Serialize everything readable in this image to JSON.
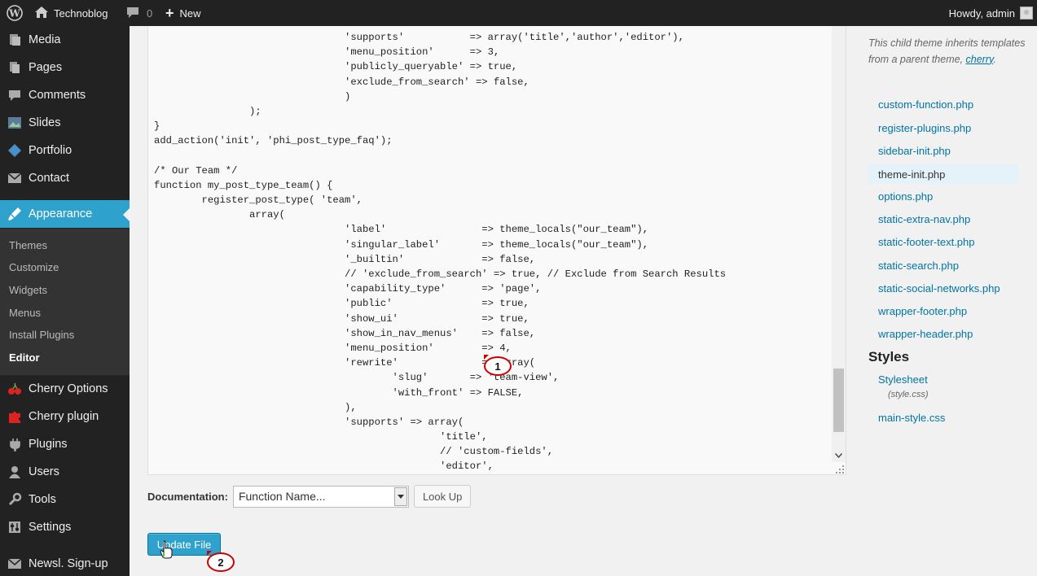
{
  "admin_bar": {
    "site_name": "Technoblog",
    "comments_count": "0",
    "new_label": "New",
    "howdy": "Howdy, admin"
  },
  "menu": {
    "items": [
      {
        "label": "Media",
        "icon": "media-icon"
      },
      {
        "label": "Pages",
        "icon": "pages-icon"
      },
      {
        "label": "Comments",
        "icon": "comments-icon"
      },
      {
        "label": "Slides",
        "icon": "slides-icon"
      },
      {
        "label": "Portfolio",
        "icon": "portfolio-icon"
      },
      {
        "label": "Contact",
        "icon": "contact-icon"
      },
      {
        "label": "Appearance",
        "icon": "appearance-icon"
      },
      {
        "label": "Cherry Options",
        "icon": "cherry-icon"
      },
      {
        "label": "Cherry plugin",
        "icon": "plugin-puzzle-icon"
      },
      {
        "label": "Plugins",
        "icon": "plugins-icon"
      },
      {
        "label": "Users",
        "icon": "users-icon"
      },
      {
        "label": "Tools",
        "icon": "tools-icon"
      },
      {
        "label": "Settings",
        "icon": "settings-icon"
      },
      {
        "label": "Newsl. Sign-up",
        "icon": "newsletter-icon"
      }
    ],
    "submenu": [
      "Themes",
      "Customize",
      "Widgets",
      "Menus",
      "Install Plugins",
      "Editor"
    ],
    "active_color": "#2ea2cc"
  },
  "editor": {
    "lines": [
      "                                'supports'           => array('title','author','editor'),",
      "                                'menu_position'      => 3,",
      "                                'publicly_queryable' => true,",
      "                                'exclude_from_search' => false,",
      "                                )",
      "                );",
      "}",
      "add_action('init', 'phi_post_type_faq');",
      "",
      "/* Our Team */",
      "function my_post_type_team() {",
      "        register_post_type( 'team',",
      "                array(",
      "                                'label'                => theme_locals(\"our_team\"),",
      "                                'singular_label'       => theme_locals(\"our_team\"),",
      "                                '_builtin'             => false,",
      "                                // 'exclude_from_search' => true, // Exclude from Search Results",
      "                                'capability_type'      => 'page',",
      "                                'public'               => true,",
      "                                'show_ui'              => true,",
      "                                'show_in_nav_menus'    => false,",
      "                                'menu_position'        => 4,",
      "                                'rewrite'              => array(",
      "                                        'slug'       => 'team-view',",
      "                                        'with_front' => FALSE,",
      "                                ),",
      "                                'supports' => array(",
      "                                                'title',",
      "                                                // 'custom-fields',",
      "                                                'editor',"
    ]
  },
  "documentation": {
    "label": "Documentation:",
    "select_value": "Function Name...",
    "lookup_label": "Look Up"
  },
  "update_button": "Update File",
  "callouts": [
    "1",
    "2"
  ],
  "sidebar": {
    "description_prefix": "This child theme inherits templates from a parent theme, ",
    "parent_theme": "cherry",
    "description_suffix": ".",
    "files": [
      "custom-function.php",
      "register-plugins.php",
      "sidebar-init.php",
      "theme-init.php",
      "options.php",
      "static-extra-nav.php",
      "static-footer-text.php",
      "static-search.php",
      "static-social-networks.php",
      "wrapper-footer.php",
      "wrapper-header.php"
    ],
    "current_file": "theme-init.php",
    "styles_heading": "Styles",
    "stylesheet_label": "Stylesheet",
    "stylesheet_file": "(style.css)",
    "style_files": [
      "main-style.css"
    ]
  }
}
